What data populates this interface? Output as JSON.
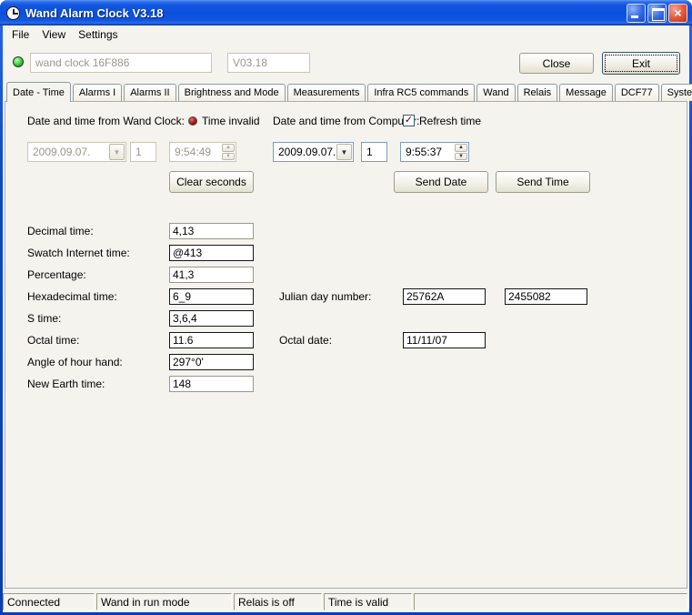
{
  "window": {
    "title": "Wand Alarm Clock V3.18"
  },
  "icons": {
    "dropdown": "▼",
    "spin_up": "▲",
    "spin_down": "▼",
    "close": "×",
    "check": "✓"
  },
  "colors": {
    "connected_led": "#30d133",
    "time_invalid_led": "#a40f0b",
    "titlebar_accent": "#0b50dc"
  },
  "menu": {
    "items": [
      "File",
      "View",
      "Settings"
    ]
  },
  "toolbar": {
    "device_name": "wand clock 16F886",
    "version": "V03.18",
    "close_label": "Close",
    "exit_label": "Exit"
  },
  "tabs": {
    "selected": "Date - Time",
    "items": [
      "Date - Time",
      "Alarms I",
      "Alarms II",
      "Brightness and Mode",
      "Measurements",
      "Infra RC5 commands",
      "Wand",
      "Relais",
      "Message",
      "DCF77",
      "System"
    ]
  },
  "datetime_panel": {
    "wand": {
      "section_label": "Date and time from Wand Clock:",
      "status_label": "Time invalid",
      "date": "2009.09.07.",
      "day": "1",
      "time": "9:54:49",
      "clear_seconds_label": "Clear seconds"
    },
    "computer": {
      "section_label": "Date and time from Computer:",
      "refresh_label": "Refresh time",
      "refresh_checked": true,
      "date": "2009.09.07.",
      "day": "1",
      "time": "9:55:37",
      "send_date_label": "Send Date",
      "send_time_label": "Send Time"
    },
    "time_fields": [
      {
        "label": "Decimal time:",
        "value": "4,13"
      },
      {
        "label": "Swatch Internet time:",
        "value": "@413"
      },
      {
        "label": "Percentage:",
        "value": "41,3"
      },
      {
        "label": "Hexadecimal time:",
        "value": "6_9"
      },
      {
        "label": "S time:",
        "value": "3,6,4"
      },
      {
        "label": "Octal time:",
        "value": "11.6"
      },
      {
        "label": "Angle of hour hand:",
        "value": "297°0'"
      },
      {
        "label": "New Earth time:",
        "value": "148"
      }
    ],
    "julian_day": {
      "label": "Julian day number:",
      "hex_value": "25762A",
      "decimal_value": "2455082"
    },
    "octal_date": {
      "label": "Octal date:",
      "value": "11/11/07"
    }
  },
  "statusbar": {
    "panels": [
      "Connected",
      "Wand in run mode",
      "Relais is off",
      "Time is valid",
      ""
    ]
  }
}
